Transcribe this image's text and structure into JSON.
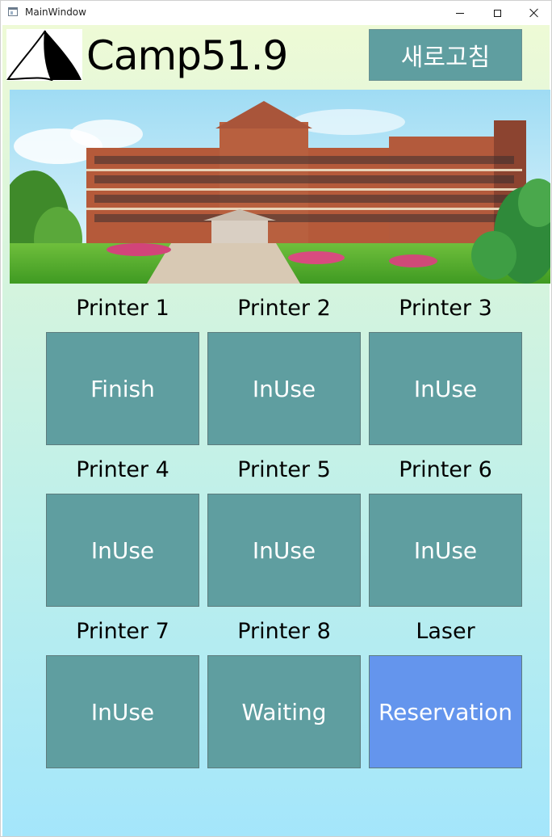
{
  "window": {
    "title": "MainWindow"
  },
  "header": {
    "app_name": "Camp51.9",
    "refresh_label": "새로고침"
  },
  "printers": [
    {
      "name": "Printer 1",
      "status": "Finish"
    },
    {
      "name": "Printer 2",
      "status": "InUse"
    },
    {
      "name": "Printer 3",
      "status": "InUse"
    },
    {
      "name": "Printer 4",
      "status": "InUse"
    },
    {
      "name": "Printer 5",
      "status": "InUse"
    },
    {
      "name": "Printer 6",
      "status": "InUse"
    },
    {
      "name": "Printer 7",
      "status": "InUse"
    },
    {
      "name": "Printer 8",
      "status": "Waiting"
    },
    {
      "name": "Laser",
      "status": "Reservation"
    }
  ],
  "colors": {
    "button": "#5f9ea0",
    "reservation_button": "#6495ed",
    "background_top": "#eefad6",
    "background_bottom": "#a4e6fb"
  },
  "icons": {
    "logo": "sail-logo",
    "banner": "school-building-photo"
  }
}
